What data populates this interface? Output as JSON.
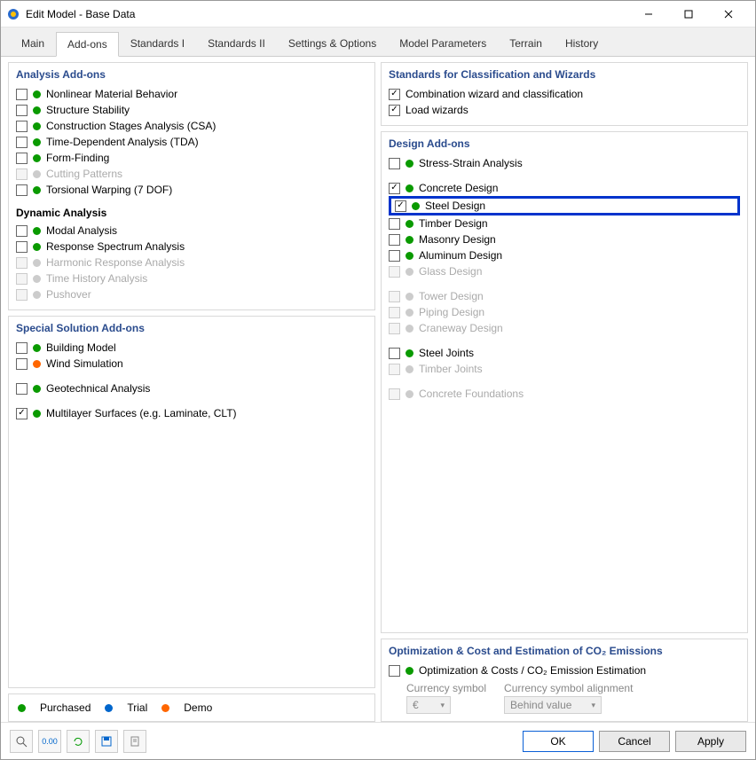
{
  "window": {
    "title": "Edit Model - Base Data"
  },
  "tabs": [
    "Main",
    "Add-ons",
    "Standards I",
    "Standards II",
    "Settings & Options",
    "Model Parameters",
    "Terrain",
    "History"
  ],
  "active_tab": 1,
  "left": {
    "analysis_title": "Analysis Add-ons",
    "analysis": [
      {
        "label": "Nonlinear Material Behavior",
        "dot": "green",
        "checked": false,
        "enabled": true
      },
      {
        "label": "Structure Stability",
        "dot": "green",
        "checked": false,
        "enabled": true
      },
      {
        "label": "Construction Stages Analysis (CSA)",
        "dot": "green",
        "checked": false,
        "enabled": true
      },
      {
        "label": "Time-Dependent Analysis (TDA)",
        "dot": "green",
        "checked": false,
        "enabled": true
      },
      {
        "label": "Form-Finding",
        "dot": "green",
        "checked": false,
        "enabled": true
      },
      {
        "label": "Cutting Patterns",
        "dot": "grey",
        "checked": false,
        "enabled": false
      },
      {
        "label": "Torsional Warping (7 DOF)",
        "dot": "green",
        "checked": false,
        "enabled": true
      }
    ],
    "dynamic_title": "Dynamic Analysis",
    "dynamic": [
      {
        "label": "Modal Analysis",
        "dot": "green",
        "checked": false,
        "enabled": true
      },
      {
        "label": "Response Spectrum Analysis",
        "dot": "green",
        "checked": false,
        "enabled": true
      },
      {
        "label": "Harmonic Response Analysis",
        "dot": "grey",
        "checked": false,
        "enabled": false
      },
      {
        "label": "Time History Analysis",
        "dot": "grey",
        "checked": false,
        "enabled": false
      },
      {
        "label": "Pushover",
        "dot": "grey",
        "checked": false,
        "enabled": false
      }
    ],
    "special_title": "Special Solution Add-ons",
    "special": [
      {
        "label": "Building Model",
        "dot": "green",
        "checked": false,
        "enabled": true
      },
      {
        "label": "Wind Simulation",
        "dot": "orange",
        "checked": false,
        "enabled": true
      },
      {
        "label": "Geotechnical Analysis",
        "dot": "green",
        "checked": false,
        "enabled": true
      },
      {
        "label": "Multilayer Surfaces (e.g. Laminate, CLT)",
        "dot": "green",
        "checked": true,
        "enabled": true
      }
    ]
  },
  "right": {
    "standards_title": "Standards for Classification and Wizards",
    "standards": [
      {
        "label": "Combination wizard and classification",
        "checked": true,
        "enabled": true
      },
      {
        "label": "Load wizards",
        "checked": true,
        "enabled": true
      }
    ],
    "design_title": "Design Add-ons",
    "design_group1": [
      {
        "label": "Stress-Strain Analysis",
        "dot": "green",
        "checked": false,
        "enabled": true
      }
    ],
    "design_group2": [
      {
        "label": "Concrete Design",
        "dot": "green",
        "checked": true,
        "enabled": true
      },
      {
        "label": "Steel Design",
        "dot": "green",
        "checked": true,
        "enabled": true,
        "highlight": true
      },
      {
        "label": "Timber Design",
        "dot": "green",
        "checked": false,
        "enabled": true
      },
      {
        "label": "Masonry Design",
        "dot": "green",
        "checked": false,
        "enabled": true
      },
      {
        "label": "Aluminum Design",
        "dot": "green",
        "checked": false,
        "enabled": true
      },
      {
        "label": "Glass Design",
        "dot": "grey",
        "checked": false,
        "enabled": false
      }
    ],
    "design_group3": [
      {
        "label": "Tower Design",
        "dot": "grey",
        "checked": false,
        "enabled": false
      },
      {
        "label": "Piping Design",
        "dot": "grey",
        "checked": false,
        "enabled": false
      },
      {
        "label": "Craneway Design",
        "dot": "grey",
        "checked": false,
        "enabled": false
      }
    ],
    "design_group4": [
      {
        "label": "Steel Joints",
        "dot": "green",
        "checked": false,
        "enabled": true
      },
      {
        "label": "Timber Joints",
        "dot": "grey",
        "checked": false,
        "enabled": false
      }
    ],
    "design_group5": [
      {
        "label": "Concrete Foundations",
        "dot": "grey",
        "checked": false,
        "enabled": false
      }
    ],
    "optimization_title": "Optimization & Cost and Estimation of CO₂ Emissions",
    "optimization": [
      {
        "label": "Optimization & Costs / CO₂ Emission Estimation",
        "dot": "green",
        "checked": false,
        "enabled": true
      }
    ],
    "opt_currency_label": "Currency symbol",
    "opt_currency_value": "€",
    "opt_align_label": "Currency symbol alignment",
    "opt_align_value": "Behind value"
  },
  "legend": {
    "purchased": "Purchased",
    "trial": "Trial",
    "demo": "Demo"
  },
  "footer": {
    "ok": "OK",
    "cancel": "Cancel",
    "apply": "Apply"
  }
}
